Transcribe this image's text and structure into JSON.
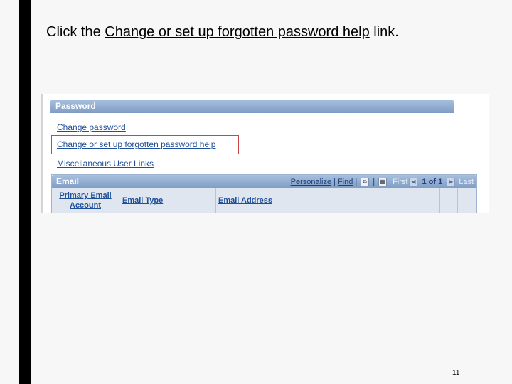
{
  "instruction": {
    "prefix": "Click the ",
    "link": "Change or set up forgotten password help",
    "suffix": " link."
  },
  "password_section": {
    "title": "Password",
    "links": [
      "Change password",
      "Change or set up forgotten password help",
      "Miscellaneous User Links"
    ]
  },
  "email_grid": {
    "title": "Email",
    "nav": {
      "personalize": "Personalize",
      "find": "Find",
      "separator": "|",
      "view_icon": "view-all-icon",
      "download_icon": "download-grid-icon",
      "first": "First",
      "count": "1 of 1",
      "last": "Last"
    },
    "columns": [
      "Primary Email Account",
      "Email Type",
      "Email Address"
    ]
  },
  "page_number": "11",
  "colors": {
    "header_blue": "#7e9cc4",
    "link_blue": "#1f4f9a",
    "highlight_red": "#cc4444"
  }
}
